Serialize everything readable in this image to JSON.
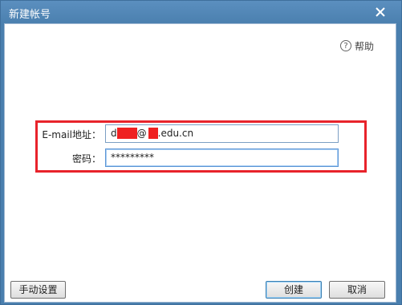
{
  "window": {
    "title": "新建帐号"
  },
  "help": {
    "label": "帮助"
  },
  "form": {
    "email_label": "E-mail地址：",
    "email_value_parts": [
      "d",
      "@",
      ".edu.cn"
    ],
    "password_label": "密码：",
    "password_value": "*********"
  },
  "buttons": {
    "manual_settings": "手动设置",
    "create": "创建",
    "cancel": "取消"
  },
  "colors": {
    "title_bar": "#4a7fae",
    "highlight_border": "#e8232b",
    "redaction": "#ef2020"
  }
}
